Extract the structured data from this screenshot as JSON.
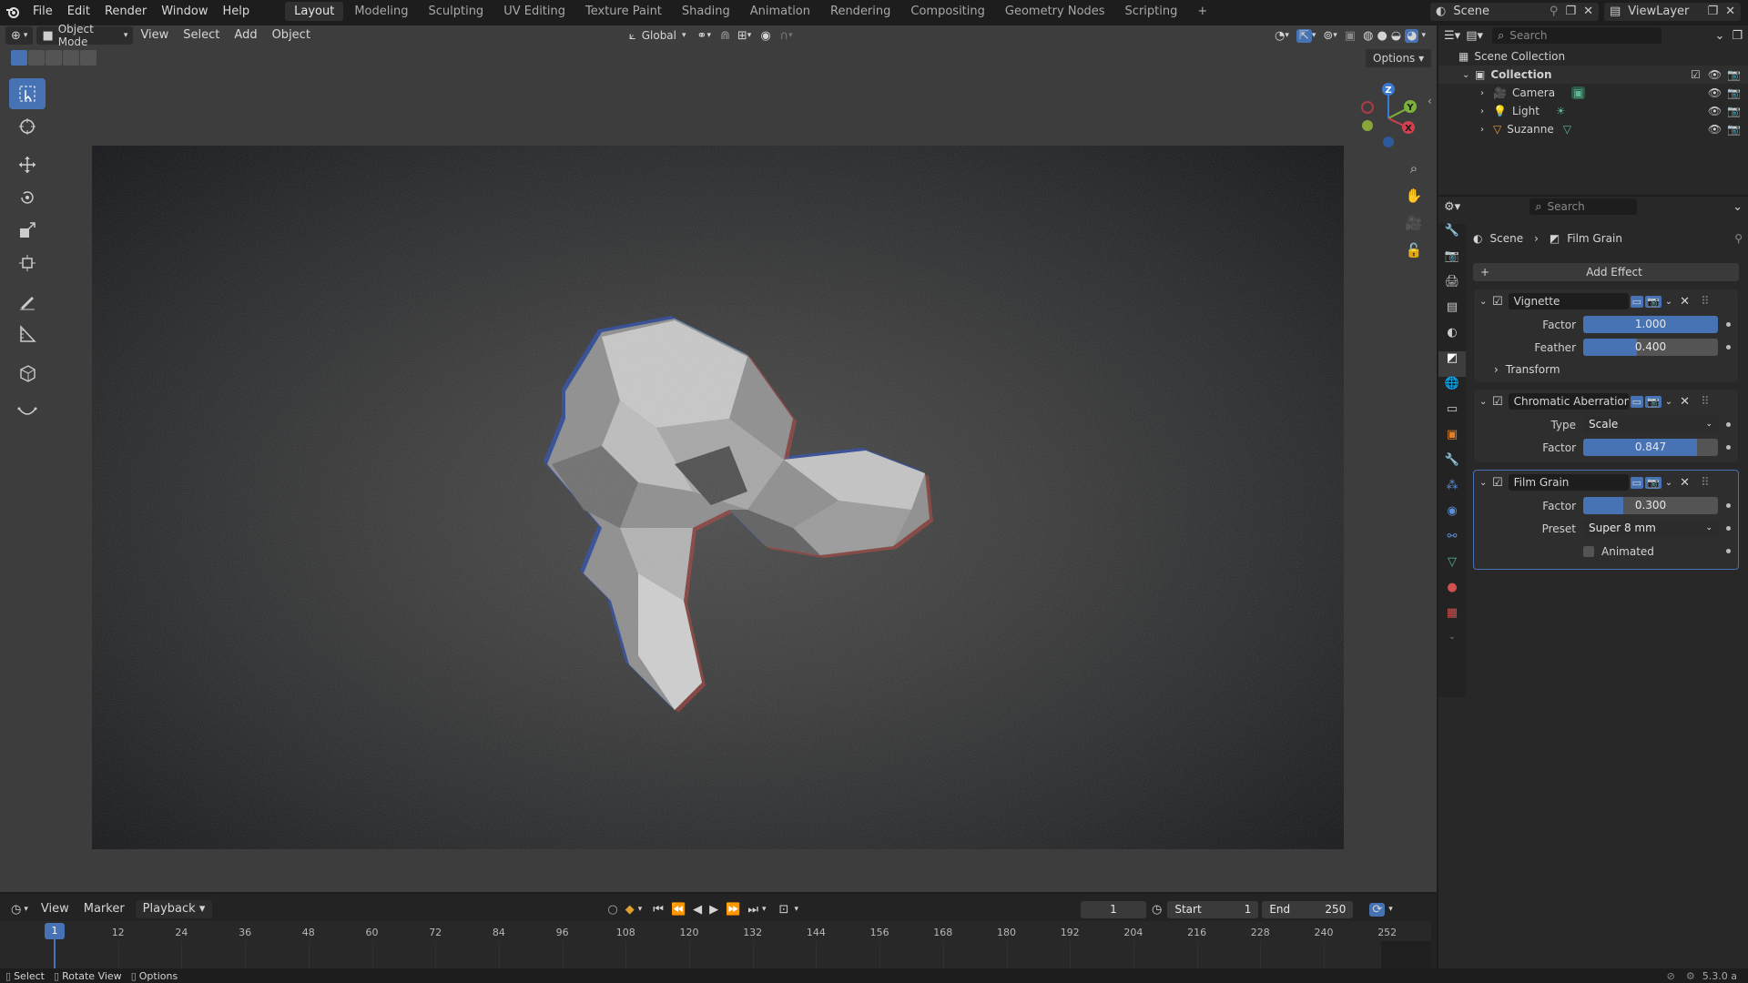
{
  "topbar": {
    "menus": [
      "File",
      "Edit",
      "Render",
      "Window",
      "Help"
    ],
    "workspaces": [
      "Layout",
      "Modeling",
      "Sculpting",
      "UV Editing",
      "Texture Paint",
      "Shading",
      "Animation",
      "Rendering",
      "Compositing",
      "Geometry Nodes",
      "Scripting"
    ],
    "active_workspace": "Layout",
    "scene": "Scene",
    "view_layer": "ViewLayer"
  },
  "viewport_header": {
    "mode": "Object Mode",
    "menus": [
      "View",
      "Select",
      "Add",
      "Object"
    ],
    "orientation": "Global",
    "options": "Options"
  },
  "gizmo": {
    "z": "Z",
    "y": "Y",
    "x": "X"
  },
  "outliner": {
    "search_placeholder": "Search",
    "root": "Scene Collection",
    "collection": "Collection",
    "items": [
      "Camera",
      "Light",
      "Suzanne"
    ]
  },
  "properties": {
    "search_placeholder": "Search",
    "breadcrumb": [
      "Scene",
      "Film Grain"
    ],
    "add_effect": "Add Effect",
    "vignette": {
      "name": "Vignette",
      "factor_label": "Factor",
      "factor": "1.000",
      "factor_fill": 1.0,
      "feather_label": "Feather",
      "feather": "0.400",
      "feather_fill": 0.4,
      "transform": "Transform"
    },
    "chromatic": {
      "name": "Chromatic Aberration",
      "type_label": "Type",
      "type": "Scale",
      "factor_label": "Factor",
      "factor": "0.847",
      "factor_fill": 0.847
    },
    "film_grain": {
      "name": "Film Grain",
      "factor_label": "Factor",
      "factor": "0.300",
      "factor_fill": 0.3,
      "preset_label": "Preset",
      "preset": "Super 8 mm",
      "animated": "Animated"
    }
  },
  "timeline": {
    "menus": [
      "View",
      "Marker",
      "Playback"
    ],
    "current_frame": "1",
    "start_label": "Start",
    "start": "1",
    "end_label": "End",
    "end": "250",
    "ticks": [
      "1",
      "12",
      "24",
      "36",
      "48",
      "60",
      "72",
      "84",
      "96",
      "108",
      "120",
      "132",
      "144",
      "156",
      "168",
      "180",
      "192",
      "204",
      "216",
      "228",
      "240",
      "252"
    ]
  },
  "status": {
    "select": "Select",
    "rotate": "Rotate View",
    "options": "Options",
    "version": "5.3.0 a"
  },
  "colors": {
    "accent": "#4772b3",
    "bg": "#1d1d1d",
    "panel": "#2e2e2e"
  }
}
